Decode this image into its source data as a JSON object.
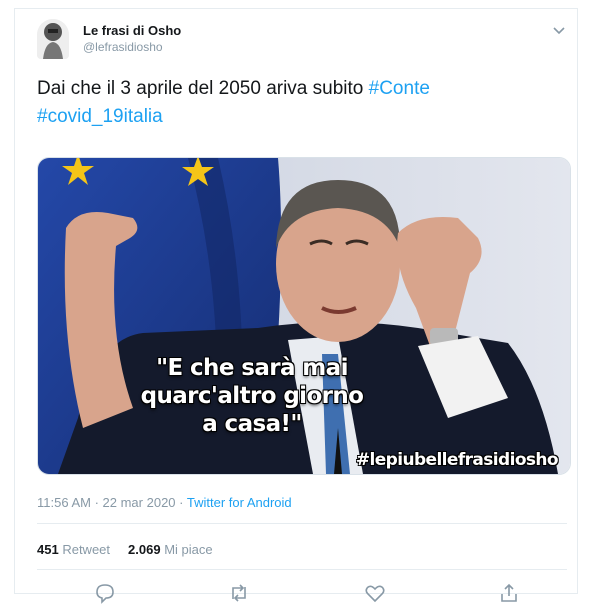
{
  "user": {
    "display_name": "Le frasi di Osho",
    "handle": "@lefrasidiosho"
  },
  "tweet": {
    "text_plain": "Dai che il 3 aprile del 2050 ariva subito",
    "hashtag_1": "#Conte",
    "hashtag_2": "#covid_19italia"
  },
  "media": {
    "quote_line_1": "\"E che sarà mai",
    "quote_line_2": "quarc'altro giorno",
    "quote_line_3": "a casa!\"",
    "watermark": "#lepiubellefrasidiosho"
  },
  "meta": {
    "time": "11:56 AM",
    "separator": " · ",
    "date": "22 mar 2020",
    "client": "Twitter for Android"
  },
  "stats": {
    "retweets_count": "451",
    "retweets_label": "Retweet",
    "likes_count": "2.069",
    "likes_label": "Mi piace"
  },
  "actions": {
    "icons": [
      "reply-icon",
      "retweet-icon",
      "like-icon",
      "share-icon"
    ]
  },
  "colors": {
    "link": "#1da1f2",
    "muted": "#8899a6",
    "text": "#14171a",
    "eu_blue": "#1d3d8f",
    "eu_star": "#f5c518"
  }
}
